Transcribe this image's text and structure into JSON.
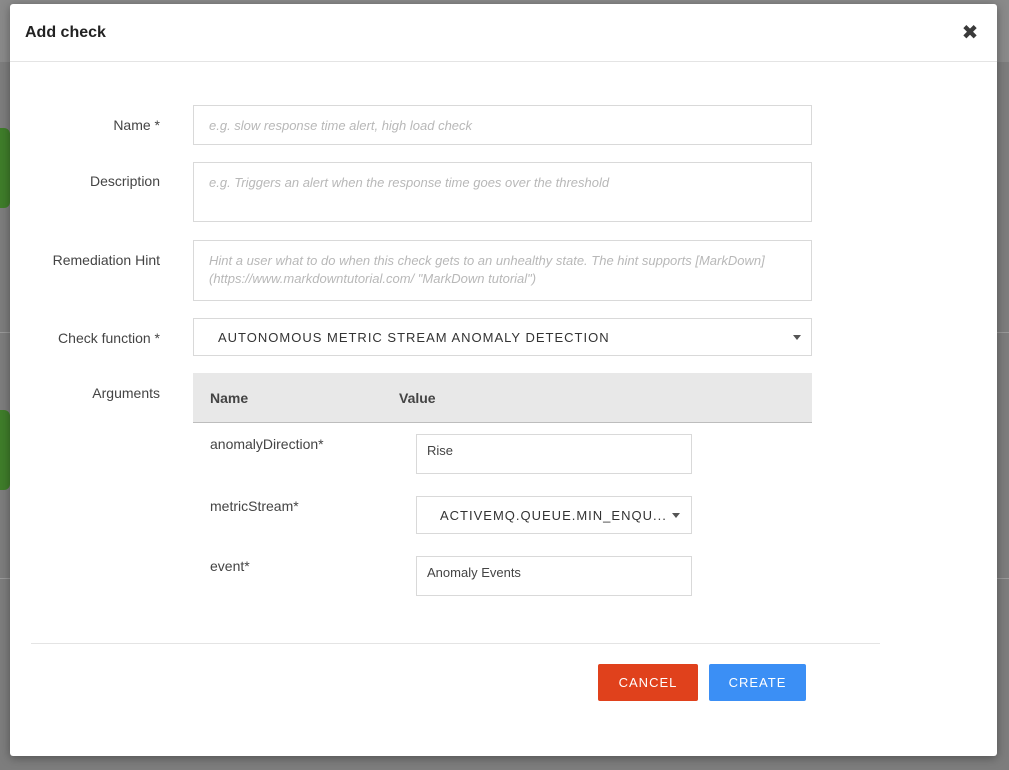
{
  "modal": {
    "title": "Add check",
    "close_icon": "close-icon"
  },
  "form": {
    "name": {
      "label": "Name *",
      "placeholder": "e.g. slow response time alert, high load check"
    },
    "description": {
      "label": "Description",
      "placeholder": "e.g. Triggers an alert when the response time goes over the threshold"
    },
    "remediation_hint": {
      "label": "Remediation Hint",
      "placeholder": "Hint a user what to do when this check gets to an unhealthy state. The hint supports [MarkDown](https://www.markdowntutorial.com/ \"MarkDown tutorial\")"
    },
    "check_function": {
      "label": "Check function *",
      "value": "AUTONOMOUS METRIC STREAM ANOMALY DETECTION"
    },
    "arguments": {
      "label": "Arguments",
      "columns": [
        "Name",
        "Value"
      ],
      "rows": [
        {
          "name": "anomalyDirection*",
          "value": "Rise",
          "kind": "input"
        },
        {
          "name": "metricStream*",
          "value": "ACTIVEMQ.QUEUE.MIN_ENQU...",
          "kind": "select"
        },
        {
          "name": "event*",
          "value": "Anomaly Events",
          "kind": "input"
        }
      ]
    }
  },
  "footer": {
    "cancel_label": "CANCEL",
    "create_label": "CREATE"
  },
  "colors": {
    "cancel": "#e0411c",
    "create": "#3b8ff5",
    "table_header": "#e8e8e8"
  }
}
